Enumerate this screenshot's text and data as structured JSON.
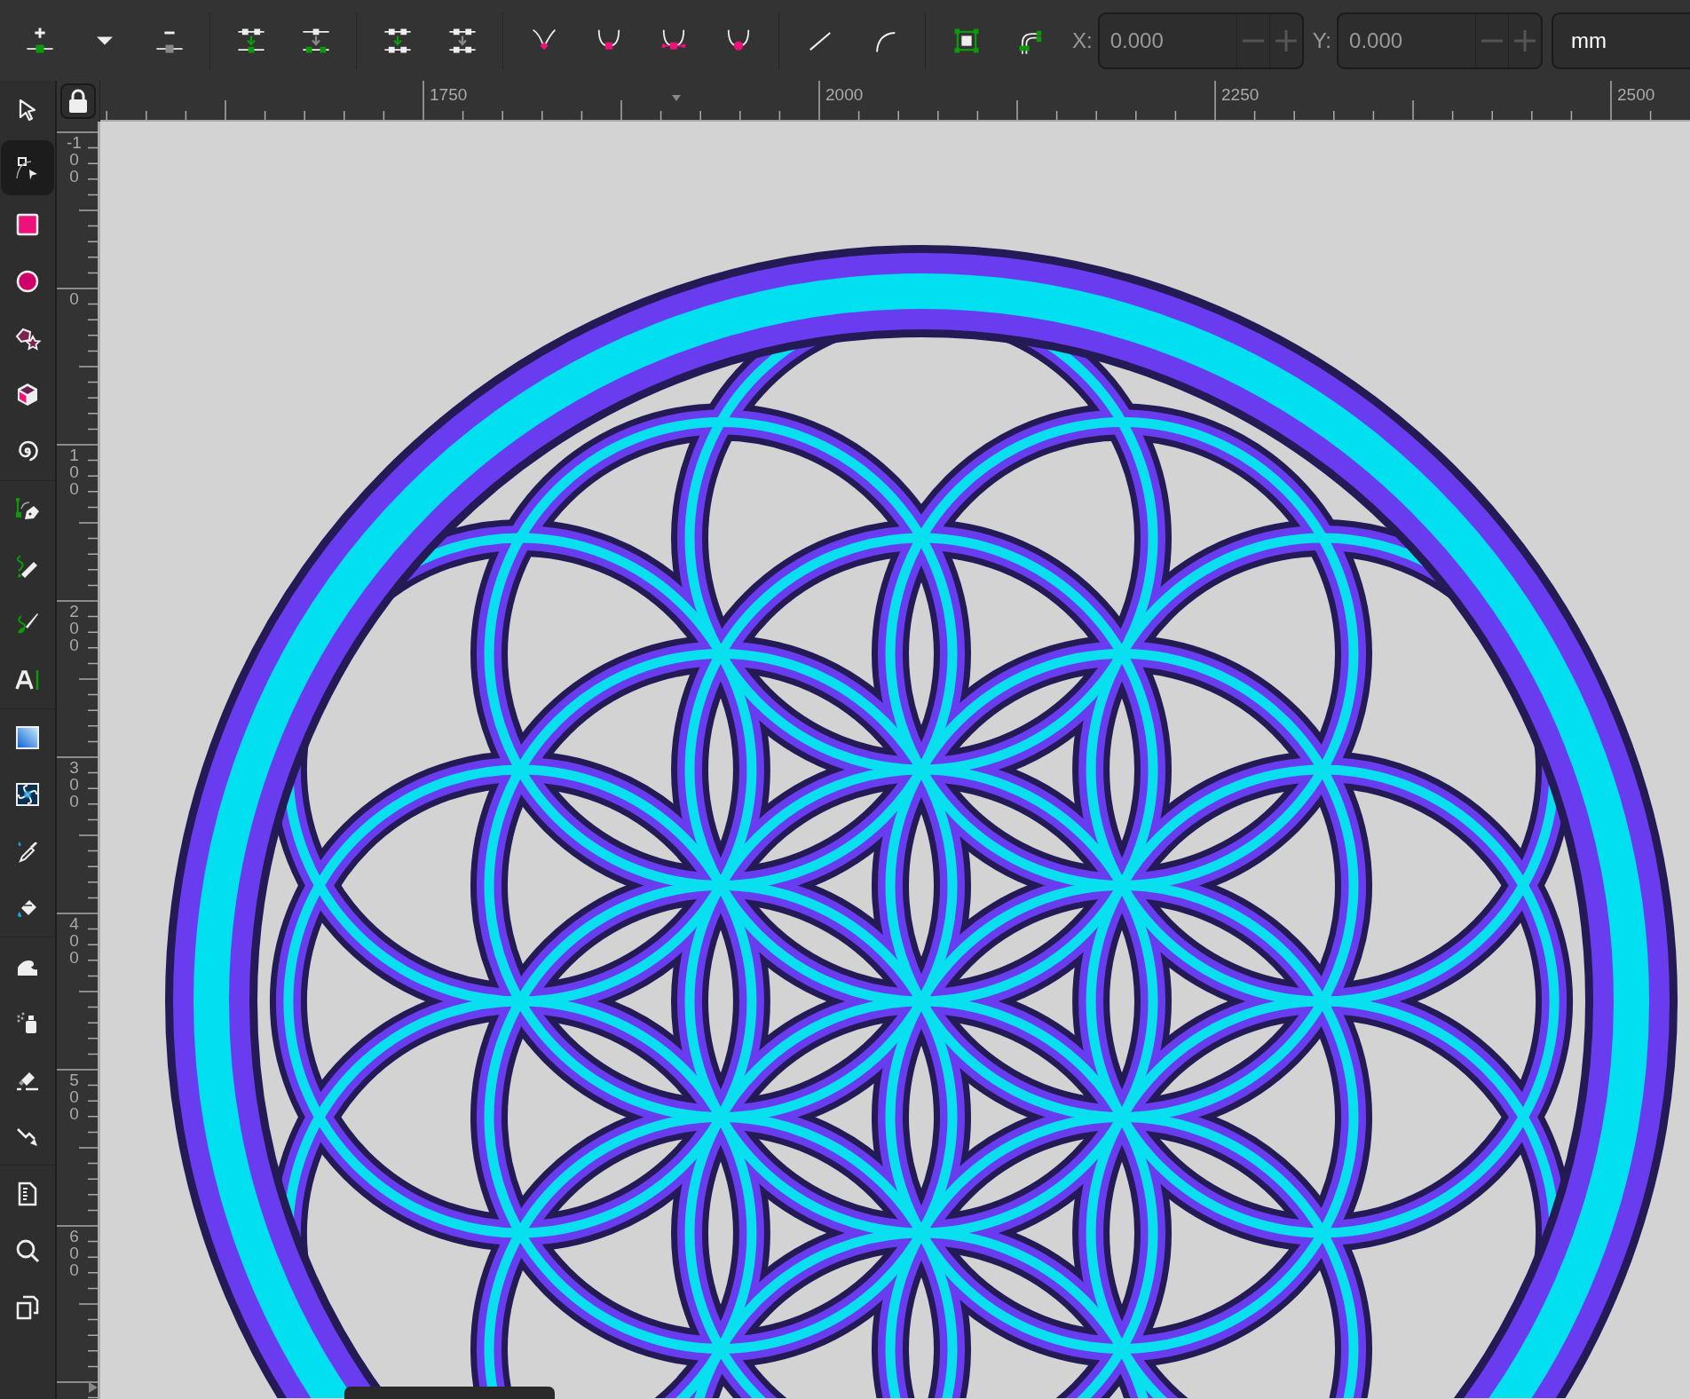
{
  "commands_bar": {
    "x_field": {
      "label": "X:",
      "value": "0.000"
    },
    "y_field": {
      "label": "Y:",
      "value": "0.000"
    },
    "unit": "mm"
  },
  "rulers": {
    "horizontal": [
      "1750",
      "2000",
      "2250",
      "2500"
    ],
    "vertical": [
      "-100",
      "0",
      "100",
      "200",
      "300",
      "400",
      "500",
      "600"
    ]
  },
  "toolbox": {
    "groups": [
      {
        "tools": [
          {
            "kind": "selector",
            "selected": false
          },
          {
            "kind": "node",
            "selected": true
          },
          {
            "kind": "rectangle",
            "selected": false
          },
          {
            "kind": "ellipse",
            "selected": false
          },
          {
            "kind": "star",
            "selected": false
          },
          {
            "kind": "box3d",
            "selected": false
          },
          {
            "kind": "spiral",
            "selected": false
          }
        ]
      },
      {
        "tools": [
          {
            "kind": "pen",
            "selected": false
          },
          {
            "kind": "pencil",
            "selected": false
          },
          {
            "kind": "calligraphy",
            "selected": false
          },
          {
            "kind": "text",
            "selected": false
          }
        ]
      },
      {
        "tools": [
          {
            "kind": "gradient",
            "selected": false
          },
          {
            "kind": "mesh",
            "selected": false
          },
          {
            "kind": "dropper",
            "selected": false
          },
          {
            "kind": "bucket",
            "selected": false
          }
        ]
      },
      {
        "tools": [
          {
            "kind": "tweak",
            "selected": false
          },
          {
            "kind": "spray",
            "selected": false
          },
          {
            "kind": "eraser",
            "selected": false
          },
          {
            "kind": "connector",
            "selected": false
          }
        ]
      },
      {
        "tools": [
          {
            "kind": "pages",
            "selected": false
          },
          {
            "kind": "zoom",
            "selected": false
          },
          {
            "kind": "clone",
            "selected": false
          }
        ]
      }
    ]
  }
}
